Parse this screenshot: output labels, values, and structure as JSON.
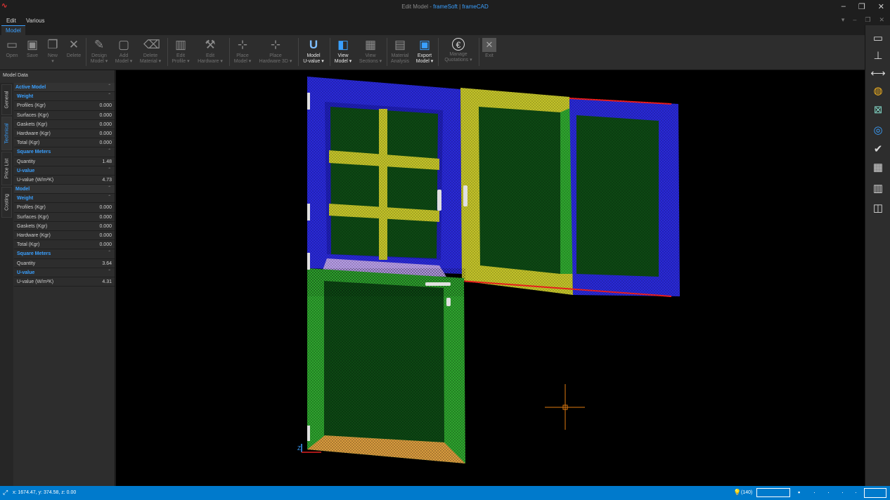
{
  "window": {
    "title_prefix": "Edit Model - ",
    "title_app": "frameSoft",
    "title_sep": " | ",
    "title_module": "frameCAD",
    "logo": "∿",
    "minimize": "–",
    "restore": "❐",
    "close": "✕"
  },
  "menu": {
    "items": [
      "Edit",
      "Various"
    ],
    "right_controls": [
      "▾",
      "–",
      "❐",
      "✕"
    ]
  },
  "tabs": {
    "active": "Model"
  },
  "ribbon": {
    "buttons": [
      {
        "label1": "Open",
        "label2": "",
        "icon": "folder-icon",
        "glyph": "▭",
        "enabled": false
      },
      {
        "label1": "Save",
        "label2": "",
        "icon": "save-icon",
        "glyph": "▣",
        "enabled": false
      },
      {
        "label1": "New",
        "label2": "▾",
        "icon": "new-icon",
        "glyph": "❐",
        "enabled": false
      },
      {
        "label1": "Delete",
        "label2": "",
        "icon": "delete-icon",
        "glyph": "✕",
        "enabled": false
      },
      {
        "label1": "Design",
        "label2": "Model ▾",
        "icon": "design-icon",
        "glyph": "✎",
        "enabled": false
      },
      {
        "label1": "Add",
        "label2": "Model ▾",
        "icon": "add-model-icon",
        "glyph": "▢",
        "enabled": false
      },
      {
        "label1": "Delete",
        "label2": "Material ▾",
        "icon": "eraser-icon",
        "glyph": "⌫",
        "enabled": false
      },
      {
        "label1": "Edit",
        "label2": "Profile ▾",
        "icon": "profile-icon",
        "glyph": "▥",
        "enabled": false
      },
      {
        "label1": "Edit",
        "label2": "Hardware ▾",
        "icon": "hardware-icon",
        "glyph": "⚒",
        "enabled": false
      },
      {
        "label1": "Place",
        "label2": "Model ▾",
        "icon": "place-model-icon",
        "glyph": "⊹",
        "enabled": false
      },
      {
        "label1": "Place",
        "label2": "Hardware 3D ▾",
        "icon": "place-hardware-icon",
        "glyph": "⊹",
        "enabled": false
      },
      {
        "label1": "Model",
        "label2": "U-value ▾",
        "icon": "u-value-icon",
        "glyph": "U",
        "enabled": true
      },
      {
        "label1": "View",
        "label2": "Model ▾",
        "icon": "cube-icon",
        "glyph": "◧",
        "enabled": true
      },
      {
        "label1": "View",
        "label2": "Sections ▾",
        "icon": "sections-icon",
        "glyph": "▦",
        "enabled": false
      },
      {
        "label1": "Material",
        "label2": "Analysis",
        "icon": "document-icon",
        "glyph": "▤",
        "enabled": false
      },
      {
        "label1": "Export",
        "label2": "Model ▾",
        "icon": "export-icon",
        "glyph": "▣",
        "enabled": true
      },
      {
        "label1": "Manage",
        "label2": "Quotations ▾",
        "icon": "euro-icon",
        "glyph": "€",
        "enabled": false
      },
      {
        "label1": "Exit",
        "label2": "",
        "icon": "exit-icon",
        "glyph": "✕",
        "enabled": false
      }
    ]
  },
  "right_toolbar": [
    {
      "icon": "panel-icon",
      "glyph": "▭"
    },
    {
      "icon": "axis-icon",
      "glyph": "⊥"
    },
    {
      "icon": "dimension-icon",
      "glyph": "⟷"
    },
    {
      "icon": "globe-icon",
      "glyph": "◍"
    },
    {
      "icon": "zoom-fit-icon",
      "glyph": "⊠"
    },
    {
      "icon": "orbit-icon",
      "glyph": "◎"
    },
    {
      "icon": "check-icon",
      "glyph": "✔"
    },
    {
      "icon": "grid-icon",
      "glyph": "▦"
    },
    {
      "icon": "section-icon",
      "glyph": "▥"
    },
    {
      "icon": "split-icon",
      "glyph": "◫"
    }
  ],
  "left_panel": {
    "title": "Model Data",
    "vertical_tabs": [
      "General",
      "Technical",
      "Price List",
      "Costing"
    ],
    "active_tab": "Technical",
    "rows": [
      {
        "type": "sec",
        "label": "Active Model",
        "value": ""
      },
      {
        "type": "sub",
        "label": "Weight",
        "value": ""
      },
      {
        "type": "row",
        "label": "Profiles (Kgr)",
        "value": "0.000"
      },
      {
        "type": "row",
        "label": "Surfaces (Kgr)",
        "value": "0.000"
      },
      {
        "type": "row",
        "label": "Gaskets (Kgr)",
        "value": "0.000"
      },
      {
        "type": "row",
        "label": "Hardware (Kgr)",
        "value": "0.000"
      },
      {
        "type": "row",
        "label": "Total (Kgr)",
        "value": "0.000"
      },
      {
        "type": "sub",
        "label": "Square Meters",
        "value": ""
      },
      {
        "type": "row",
        "label": "Quantity",
        "value": "1.48"
      },
      {
        "type": "sub",
        "label": "U-value",
        "value": ""
      },
      {
        "type": "row",
        "label": "U-value (W/m²K)",
        "value": "4.73"
      },
      {
        "type": "sec",
        "label": "Model",
        "value": ""
      },
      {
        "type": "sub",
        "label": "Weight",
        "value": ""
      },
      {
        "type": "row",
        "label": "Profiles (Kgr)",
        "value": "0.000"
      },
      {
        "type": "row",
        "label": "Surfaces (Kgr)",
        "value": "0.000"
      },
      {
        "type": "row",
        "label": "Gaskets (Kgr)",
        "value": "0.000"
      },
      {
        "type": "row",
        "label": "Hardware (Kgr)",
        "value": "0.000"
      },
      {
        "type": "row",
        "label": "Total (Kgr)",
        "value": "0.000"
      },
      {
        "type": "sub",
        "label": "Square Meters",
        "value": ""
      },
      {
        "type": "row",
        "label": "Quantity",
        "value": "3.64"
      },
      {
        "type": "sub",
        "label": "U-value",
        "value": ""
      },
      {
        "type": "row",
        "label": "U-value (W/m²K)",
        "value": "4.31"
      }
    ]
  },
  "viewport": {
    "colors": {
      "frame_blue": "#2a2adb",
      "sash_yellow": "#c7c72a",
      "glass_green": "#0d4a14",
      "door_green": "#2fa82f",
      "sill_purple": "#b89ee8",
      "bottom_orange": "#e0a040",
      "cursor_orange": "#e07a10",
      "outline_red": "#ff2020"
    }
  },
  "status": {
    "coords": "x: 1674.47, y: 374.58, z: 0.00",
    "zoom": "(140)",
    "accent": "#007acc"
  }
}
